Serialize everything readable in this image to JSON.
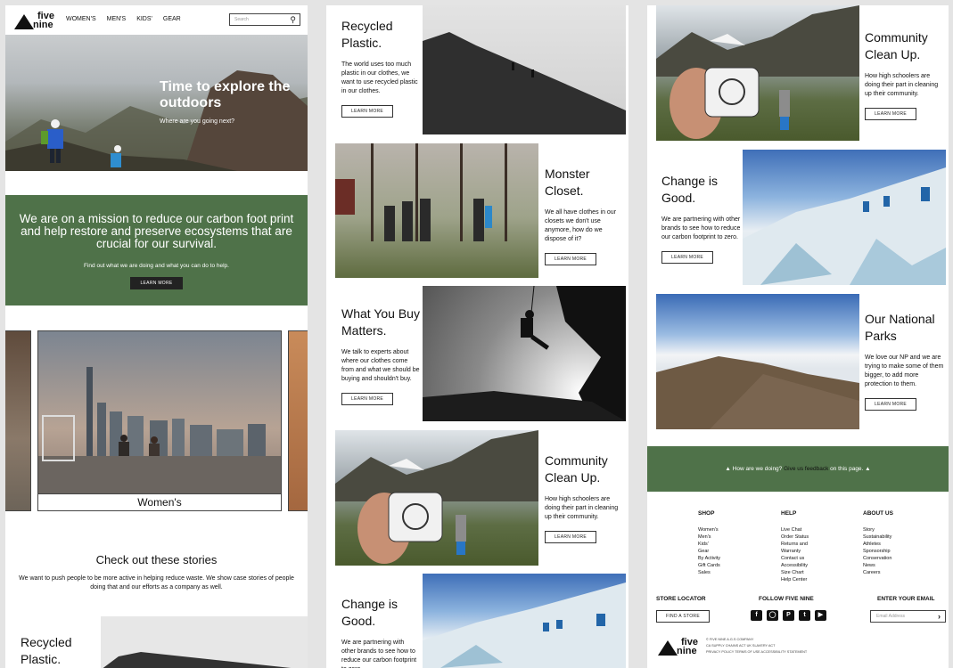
{
  "brand": {
    "line1": "five",
    "line2": "nine"
  },
  "nav": {
    "items": [
      "WOMEN'S",
      "MEN'S",
      "KIDS'",
      "GEAR"
    ],
    "search_placeholder": "Search"
  },
  "hero": {
    "title": "Time to explore the outdoors",
    "subtitle": "Where are you going next?"
  },
  "mission": {
    "heading": "We are on a mission to reduce our carbon foot print and help restore and preserve ecosystems that are crucial for our survival.",
    "text": "Find out what we are doing and what you can do to help.",
    "button": "LEARN MORE"
  },
  "carousel": {
    "active_label": "Women's"
  },
  "stories_section": {
    "title": "Check out these stories",
    "text": "We want to push people to be more active in helping reduce waste. We show case stories of people doing that and our efforts as a company as well."
  },
  "stories": [
    {
      "title": "Recycled Plastic.",
      "text": "The world uses too much plastic in our clothes, we want to use recycled plastic in our clothes.",
      "button": "LEARN MORE"
    },
    {
      "title": "Monster Closet.",
      "text": "We all have clothes in our closets we don't use anymore, how do we dispose of it?",
      "button": "LEARN MORE"
    },
    {
      "title": "What You Buy Matters.",
      "text": "We talk to experts about where our clothes come from and what we should be buying and shouldn't buy.",
      "button": "LEARN MORE"
    },
    {
      "title": "Community Clean Up.",
      "text": "How high schoolers are doing their part in cleaning up their community.",
      "button": "LEARN MORE"
    },
    {
      "title": "Change is Good.",
      "text": "We are partnering with other brands to see how to reduce our carbon footprint to zero.",
      "button": "LEARN MORE"
    },
    {
      "title": "Our National Parks",
      "text": "We love our NP and we are trying to make some of them bigger, to add more protection to them.",
      "button": "LEARN MORE"
    }
  ],
  "feedback": {
    "prefix": "How are we doing? ",
    "link": "Give us feedback",
    "suffix": " on this page."
  },
  "footer": {
    "shop": {
      "title": "SHOP",
      "items": [
        "Women's",
        "Men's",
        "Kids'",
        "Gear",
        "By Activity",
        "Gift Cards",
        "Sales"
      ]
    },
    "help": {
      "title": "HELP",
      "items": [
        "Live Chat",
        "Order Status",
        "Returns and",
        "Warranty",
        "Contact us",
        "Accessibility",
        "Size Chart",
        "Help Center"
      ]
    },
    "about": {
      "title": "ABOUT US",
      "items": [
        "Story",
        "Sustainability",
        "Athletes",
        "Sponsorship",
        "Conservation",
        "News",
        "Careers"
      ]
    },
    "store_locator": {
      "title": "STORE LOCATOR",
      "button": "FIND A STORE"
    },
    "follow": {
      "title": "FOLLOW FIVE NINE"
    },
    "email": {
      "title": "ENTER YOUR EMAIL",
      "placeholder": "Email Address"
    },
    "legal": {
      "line1": "© FIVE NINE A.G.S COMPANY",
      "line2": "CA SUPPLY CHAINS ACT   UK SLAVERY ACT",
      "line3": "PRIVACY POLICY   TERMS OF USE   ACCESSIBILITY STATEMENT"
    }
  },
  "colors": {
    "green": "#4f7249",
    "dark": "#111111"
  },
  "icons": [
    "search-icon",
    "arrow-right-icon",
    "tree-icon",
    "facebook-icon",
    "instagram-icon",
    "pinterest-icon",
    "twitter-icon",
    "youtube-icon"
  ]
}
